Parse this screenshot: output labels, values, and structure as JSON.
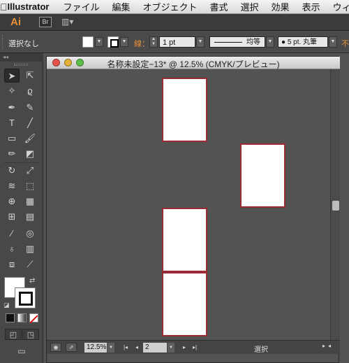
{
  "menubar": {
    "app_name": "Illustrator",
    "items": [
      "ファイル",
      "編集",
      "オブジェクト",
      "書式",
      "選択",
      "効果",
      "表示",
      "ウィン"
    ]
  },
  "appbar": {
    "logo": "Ai",
    "bridge": "Br",
    "workspace_icon": "▥▾"
  },
  "control": {
    "selection": "選択なし",
    "stroke_label": "線：",
    "stroke_weight": "1 pt",
    "profile": "均等",
    "brush": "● 5 pt. 丸筆",
    "opacity_label": "不"
  },
  "tools": {
    "collapse": "◂◂"
  },
  "document": {
    "title": "名称未設定−13* @ 12.5% (CMYK/プレビュー)",
    "artboards": 4
  },
  "statusbar": {
    "zoom": "12.5%",
    "page": "2",
    "status": "選択"
  },
  "colors": {
    "accent": "#e8913a",
    "artboard_border": "#9a2a33",
    "canvas": "#535353"
  }
}
